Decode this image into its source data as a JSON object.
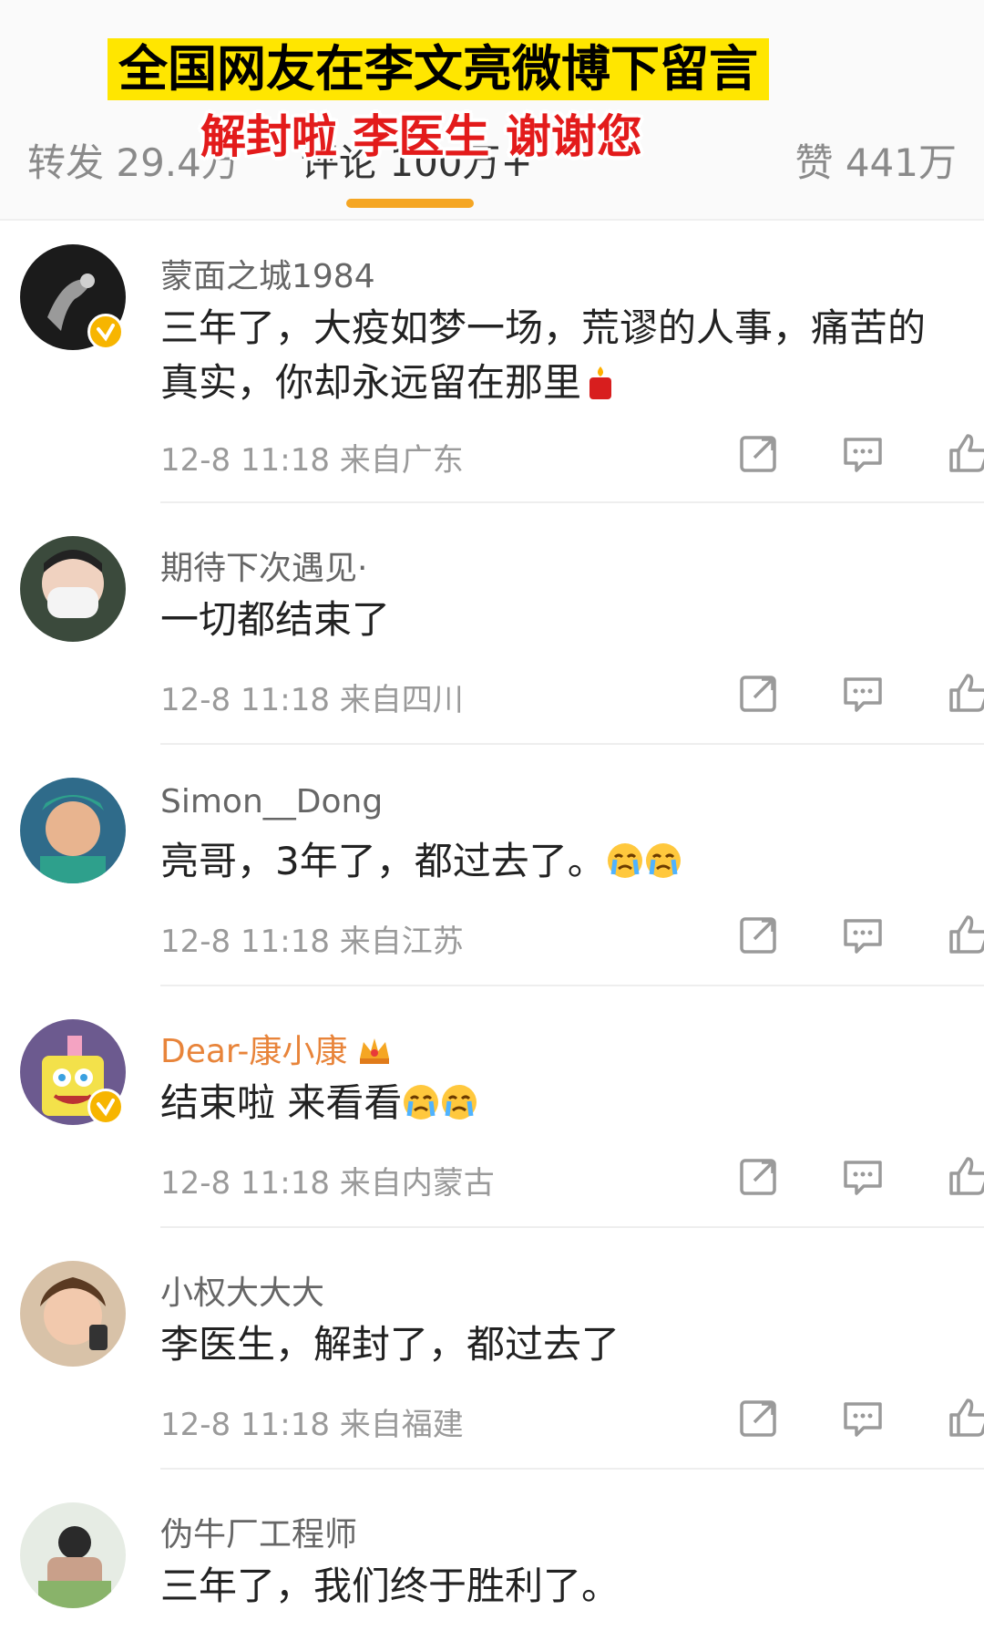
{
  "overlay": {
    "title": "全国网友在李文亮微博下留言",
    "subtitle": "解封啦 李医生 谢谢您",
    "title_bg": "#ffe600",
    "subtitle_color": "#e31b1b"
  },
  "tabs": {
    "repost": "转发 29.4万",
    "comment": "评论 100万+",
    "like": "赞 441万",
    "active_underline_color": "#f5a623"
  },
  "comments": [
    {
      "username": "蒙面之城1984",
      "verified": true,
      "text": "三年了，大疫如梦一场，荒谬的人事，痛苦的真实，你却永远留在那里",
      "emoji": "candle-emoji",
      "meta": "12-8 11:18 来自广东"
    },
    {
      "username": "期待下次遇见·",
      "verified": false,
      "text": "一切都结束了",
      "meta": "12-8 11:18 来自四川"
    },
    {
      "username": "Simon__Dong",
      "verified": false,
      "text": "亮哥，3年了，都过去了。",
      "emoji": "crying-emoji x2",
      "meta": "12-8 11:18 来自江苏"
    },
    {
      "username": "Dear-康小康",
      "verified": true,
      "username_color": "#e8843a",
      "badge": "crown-icon",
      "text": "结束啦  来看看",
      "emoji": "crying-emoji x2",
      "meta": "12-8 11:18 来自内蒙古"
    },
    {
      "username": "小权大大大",
      "verified": false,
      "text": "李医生，解封了，都过去了",
      "meta": "12-8 11:18 来自福建"
    },
    {
      "username": "伪牛厂工程师",
      "verified": false,
      "text": "三年了，我们终于胜利了。"
    }
  ],
  "icons": {
    "share": "share-icon",
    "reply": "comment-icon",
    "like": "thumbs-up-icon"
  }
}
